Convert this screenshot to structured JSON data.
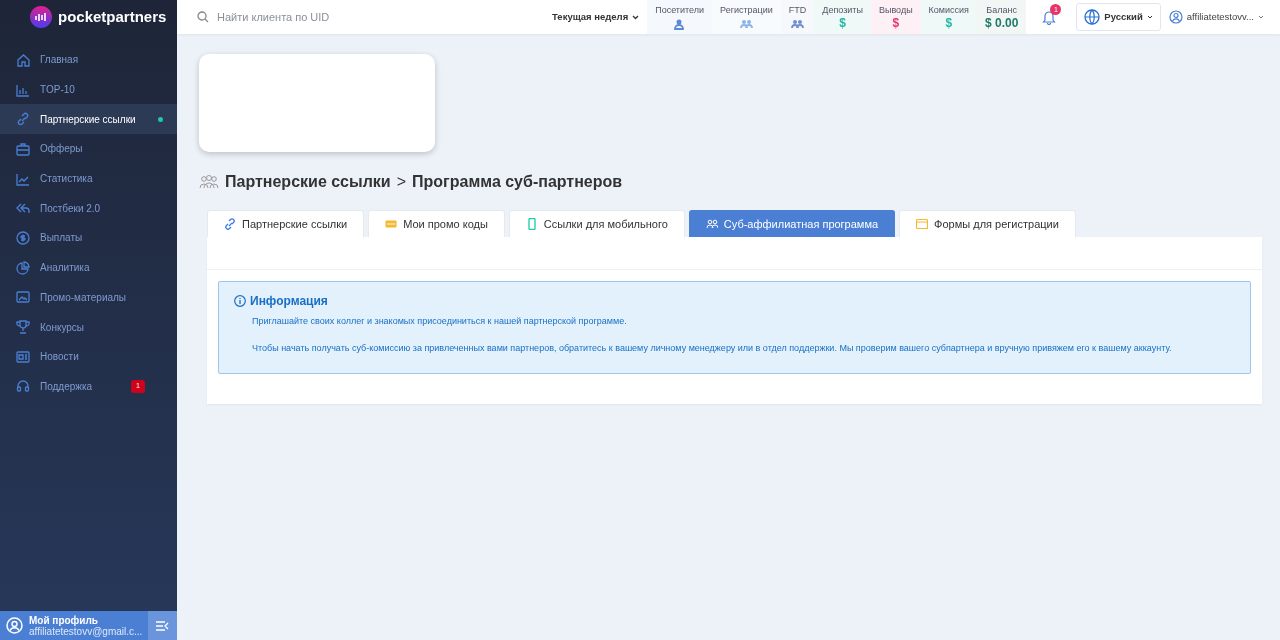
{
  "brand": {
    "name": "pocketpartners"
  },
  "search": {
    "placeholder": "Найти клиента по UID"
  },
  "period": {
    "label": "Текущая неделя"
  },
  "stats": [
    {
      "label": "Посетители",
      "kind": "icon",
      "color": "#5b8ad6"
    },
    {
      "label": "Регистрации",
      "kind": "icon",
      "color": "#8fb3e6"
    },
    {
      "label": "FTD",
      "kind": "icon",
      "color": "#6f8fd0"
    },
    {
      "label": "Депозиты",
      "kind": "value",
      "value": "$",
      "color": "#20b8a0"
    },
    {
      "label": "Выводы",
      "kind": "value",
      "value": "$",
      "color": "#e8336b"
    },
    {
      "label": "Комиссия",
      "kind": "value",
      "value": "$",
      "color": "#20b8a0"
    },
    {
      "label": "Баланс",
      "kind": "value",
      "value": "$ 0.00",
      "color": "#1f7a6a"
    }
  ],
  "notifications": {
    "count": "1"
  },
  "language": {
    "label": "Русский"
  },
  "user": {
    "name": "affiliatetestovv..."
  },
  "sidebar": {
    "items": [
      {
        "label": "Главная",
        "selected": false
      },
      {
        "label": "TOP-10",
        "selected": false
      },
      {
        "label": "Партнерские ссылки",
        "selected": true
      },
      {
        "label": "Офферы",
        "selected": false
      },
      {
        "label": "Статистика",
        "selected": false
      },
      {
        "label": "Постбеки 2.0",
        "selected": false
      },
      {
        "label": "Выплаты",
        "selected": false
      },
      {
        "label": "Аналитика",
        "selected": false
      },
      {
        "label": "Промо-материалы",
        "selected": false
      },
      {
        "label": "Конкурсы",
        "selected": false
      },
      {
        "label": "Новости",
        "selected": false
      },
      {
        "label": "Поддержка",
        "selected": false,
        "badge": "1"
      }
    ]
  },
  "profile": {
    "title": "Мой профиль",
    "email": "affiliatetestovv@gmail.c..."
  },
  "breadcrumb": {
    "parent": "Партнерские ссылки",
    "separator": ">",
    "current": "Программа суб-партнеров"
  },
  "tabs": [
    {
      "label": "Партнерские ссылки",
      "selected": false
    },
    {
      "label": "Мои промо коды",
      "selected": false
    },
    {
      "label": "Ссылки для мобильного",
      "selected": false
    },
    {
      "label": "Суб-аффилиатная программа",
      "selected": true
    },
    {
      "label": "Формы для регистрации",
      "selected": false
    }
  ],
  "info": {
    "title": "Информация",
    "paragraphs": [
      "Приглашайте своих коллег и знакомых присоединиться к нашей партнерской программе.",
      "Чтобы начать получать суб-комиссию за привлеченных вами партнеров, обратитесь к вашему личному менеджеру или в отдел поддержки. Мы проверим вашего субпартнера и вручную привяжем его к вашему аккаунту."
    ]
  }
}
